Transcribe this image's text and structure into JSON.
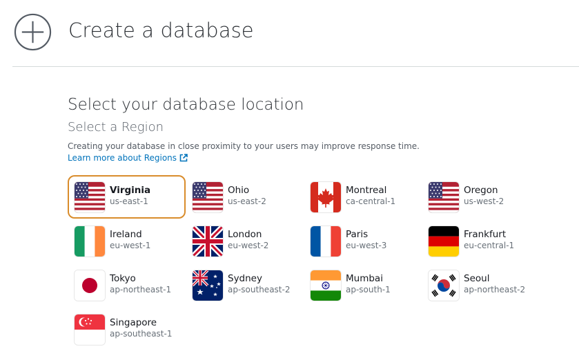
{
  "header": {
    "title": "Create a database",
    "icon": "plus-circle-icon"
  },
  "location": {
    "title": "Select your database location",
    "subtitle": "Select a Region",
    "description": "Creating your database in close proximity to your users may improve response time.",
    "learn_more": "Learn more about Regions"
  },
  "regions": [
    {
      "name": "Virginia",
      "code": "us-east-1",
      "flag": "us-flag-icon",
      "selected": true
    },
    {
      "name": "Ohio",
      "code": "us-east-2",
      "flag": "us-flag-icon"
    },
    {
      "name": "Montreal",
      "code": "ca-central-1",
      "flag": "canada-flag-icon"
    },
    {
      "name": "Oregon",
      "code": "us-west-2",
      "flag": "us-flag-icon"
    },
    {
      "name": "Ireland",
      "code": "eu-west-1",
      "flag": "ireland-flag-icon"
    },
    {
      "name": "London",
      "code": "eu-west-2",
      "flag": "uk-flag-icon"
    },
    {
      "name": "Paris",
      "code": "eu-west-3",
      "flag": "france-flag-icon"
    },
    {
      "name": "Frankfurt",
      "code": "eu-central-1",
      "flag": "germany-flag-icon"
    },
    {
      "name": "Tokyo",
      "code": "ap-northeast-1",
      "flag": "japan-flag-icon"
    },
    {
      "name": "Sydney",
      "code": "ap-southeast-2",
      "flag": "australia-flag-icon"
    },
    {
      "name": "Mumbai",
      "code": "ap-south-1",
      "flag": "india-flag-icon"
    },
    {
      "name": "Seoul",
      "code": "ap-northeast-2",
      "flag": "korea-flag-icon"
    },
    {
      "name": "Singapore",
      "code": "ap-southeast-1",
      "flag": "singapore-flag-icon"
    }
  ],
  "colors": {
    "selected_border": "#d98c2b",
    "link": "#0073bb"
  }
}
